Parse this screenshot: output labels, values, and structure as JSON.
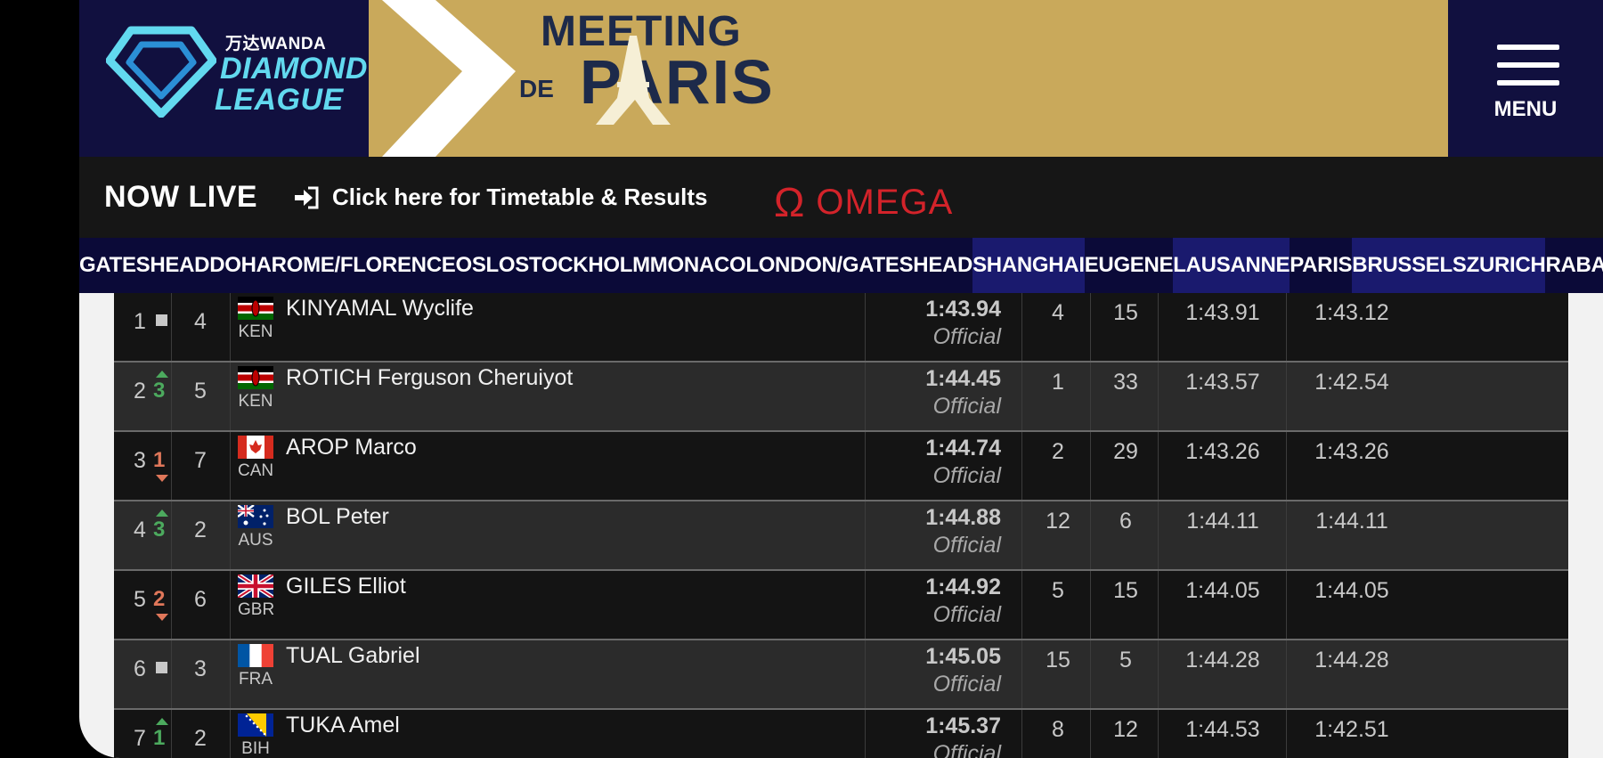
{
  "header": {
    "diamond_league": {
      "sponsor": "万达WANDA",
      "line1": "DIAMOND",
      "line2": "LEAGUE"
    },
    "meeting": {
      "line1": "MEETING",
      "de": "DE",
      "paris": "PARIS"
    },
    "menu_label": "MENU",
    "colors": {
      "navy": "#11103f",
      "gold": "#c9a95b",
      "cyan": "#62d9ef"
    }
  },
  "live_bar": {
    "now_live": "NOW LIVE",
    "link_icon": "sign-in-icon",
    "link_text": "Click here for Timetable & Results",
    "sponsor": "OMEGA",
    "sponsor_color": "#d3232a"
  },
  "meetings": [
    {
      "label": "GATESHEAD",
      "highlight": false
    },
    {
      "label": "DOHA",
      "highlight": false
    },
    {
      "label": "ROME/FLORENCE",
      "highlight": false
    },
    {
      "label": "OSLO",
      "highlight": false
    },
    {
      "label": "STOCKHOLM",
      "highlight": false
    },
    {
      "label": "MONACO",
      "highlight": false
    },
    {
      "label": "LONDON/GATESHEAD",
      "highlight": false
    },
    {
      "label": "SHANGHAI",
      "highlight": true
    },
    {
      "label": "EUGENE",
      "highlight": false
    },
    {
      "label": "LAUSANNE",
      "highlight": true
    },
    {
      "label": "PARIS",
      "highlight": false
    },
    {
      "label": "BRUSSELS",
      "highlight": true
    },
    {
      "label": "ZURICH",
      "highlight": true
    },
    {
      "label": "RABAT",
      "highlight": false
    }
  ],
  "results": [
    {
      "pos": "1",
      "move": "same",
      "move_num": "",
      "lane": "4",
      "nat": "KEN",
      "flag": "kenya-flag-icon",
      "athlete": "KINYAMAL Wyclife",
      "mark": "1:43.94",
      "status": "Official",
      "c1": "4",
      "c2": "15",
      "c3": "1:43.91",
      "c4": "1:43.12"
    },
    {
      "pos": "2",
      "move": "up",
      "move_num": "3",
      "lane": "5",
      "nat": "KEN",
      "flag": "kenya-flag-icon",
      "athlete": "ROTICH Ferguson Cheruiyot",
      "mark": "1:44.45",
      "status": "Official",
      "c1": "1",
      "c2": "33",
      "c3": "1:43.57",
      "c4": "1:42.54"
    },
    {
      "pos": "3",
      "move": "down",
      "move_num": "1",
      "lane": "7",
      "nat": "CAN",
      "flag": "canada-flag-icon",
      "athlete": "AROP Marco",
      "mark": "1:44.74",
      "status": "Official",
      "c1": "2",
      "c2": "29",
      "c3": "1:43.26",
      "c4": "1:43.26"
    },
    {
      "pos": "4",
      "move": "up",
      "move_num": "3",
      "lane": "2",
      "nat": "AUS",
      "flag": "australia-flag-icon",
      "athlete": "BOL Peter",
      "mark": "1:44.88",
      "status": "Official",
      "c1": "12",
      "c2": "6",
      "c3": "1:44.11",
      "c4": "1:44.11"
    },
    {
      "pos": "5",
      "move": "down",
      "move_num": "2",
      "lane": "6",
      "nat": "GBR",
      "flag": "uk-flag-icon",
      "athlete": "GILES Elliot",
      "mark": "1:44.92",
      "status": "Official",
      "c1": "5",
      "c2": "15",
      "c3": "1:44.05",
      "c4": "1:44.05"
    },
    {
      "pos": "6",
      "move": "same",
      "move_num": "",
      "lane": "3",
      "nat": "FRA",
      "flag": "france-flag-icon",
      "athlete": "TUAL Gabriel",
      "mark": "1:45.05",
      "status": "Official",
      "c1": "15",
      "c2": "5",
      "c3": "1:44.28",
      "c4": "1:44.28"
    },
    {
      "pos": "7",
      "move": "up",
      "move_num": "1",
      "lane": "2",
      "nat": "BIH",
      "flag": "bosnia-flag-icon",
      "athlete": "TUKA Amel",
      "mark": "1:45.37",
      "status": "Official",
      "c1": "8",
      "c2": "12",
      "c3": "1:44.53",
      "c4": "1:42.51"
    }
  ]
}
